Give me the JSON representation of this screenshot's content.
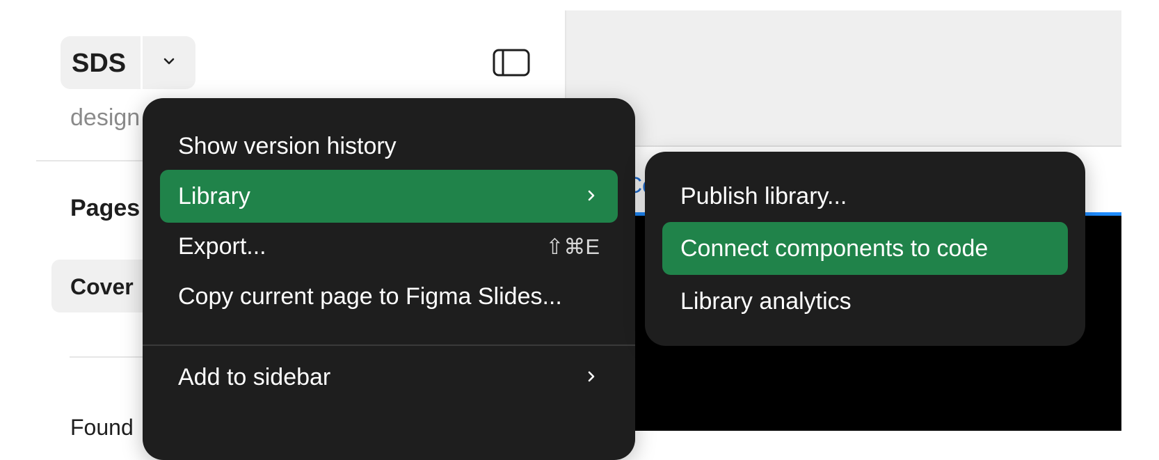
{
  "sidebar": {
    "file_name": "SDS",
    "subtitle": "design",
    "pages_label": "Pages",
    "current_page": "Cover",
    "section_label": "Found"
  },
  "canvas": {
    "link_text": "Co"
  },
  "menu": {
    "items": [
      {
        "label": "Show version history",
        "shortcut": "",
        "has_submenu": false,
        "active": false
      },
      {
        "label": "Library",
        "shortcut": "",
        "has_submenu": true,
        "active": true
      },
      {
        "label": "Export...",
        "shortcut": "⇧⌘E",
        "has_submenu": false,
        "active": false
      },
      {
        "label": "Copy current page to Figma Slides...",
        "shortcut": "",
        "has_submenu": false,
        "active": false
      },
      {
        "label": "Add to sidebar",
        "shortcut": "",
        "has_submenu": true,
        "active": false
      }
    ]
  },
  "submenu": {
    "items": [
      {
        "label": "Publish library...",
        "active": false
      },
      {
        "label": "Connect components to code",
        "active": true
      },
      {
        "label": "Library analytics",
        "active": false
      }
    ]
  },
  "colors": {
    "menu_background": "#1e1e1e",
    "highlight": "#20834a",
    "canvas_dark": "#000000",
    "selection_blue": "#1f8cff"
  }
}
